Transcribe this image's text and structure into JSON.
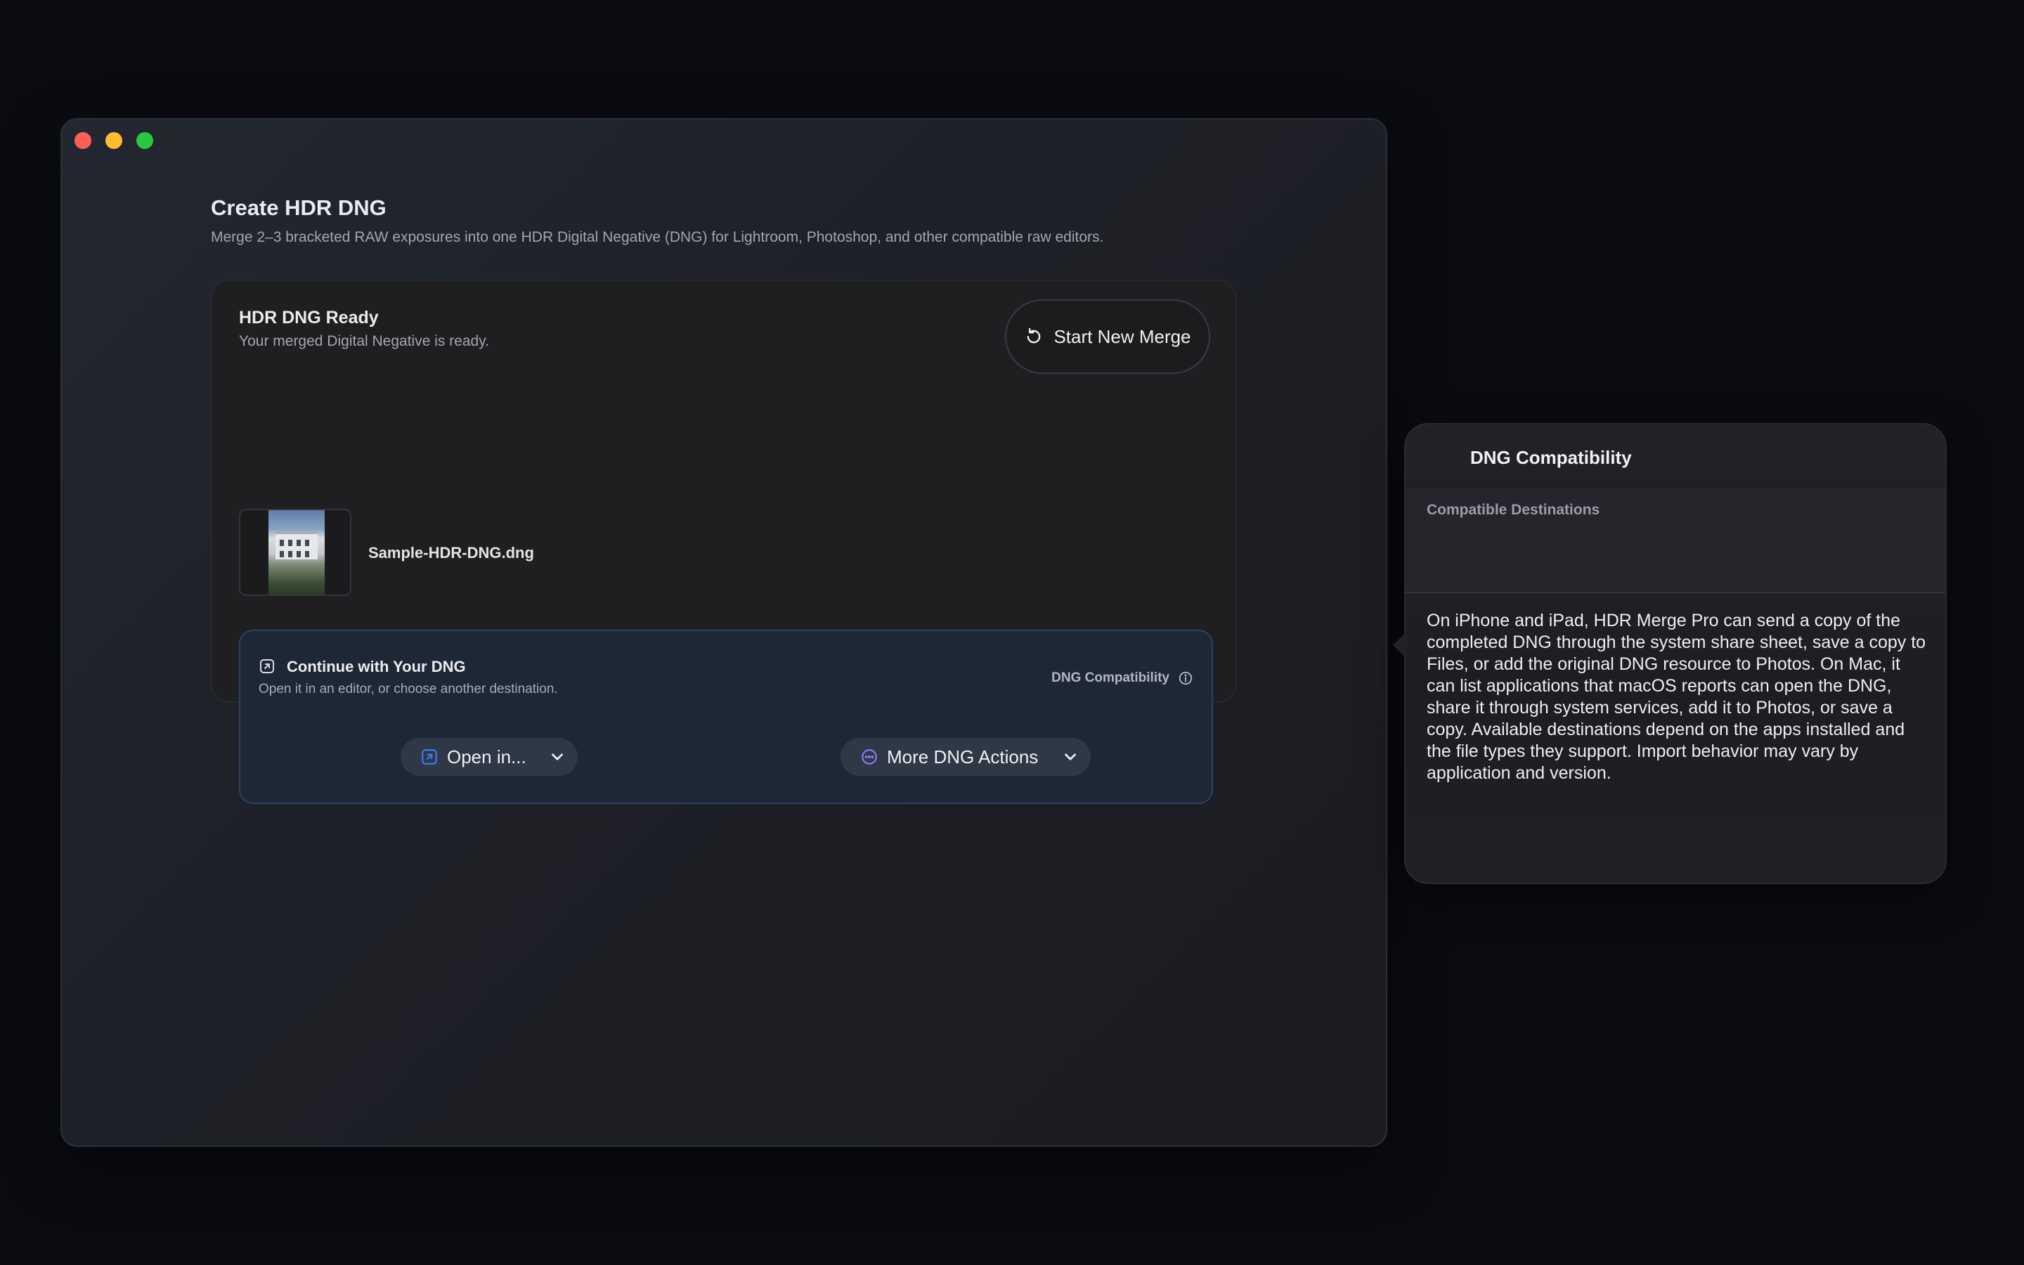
{
  "window": {
    "title": "Create HDR DNG",
    "subtitle": "Merge 2–3 bracketed RAW exposures into one HDR Digital Negative (DNG) for Lightroom, Photoshop, and other compatible raw editors."
  },
  "result_card": {
    "title": "HDR DNG Ready",
    "subtitle": "Your merged Digital Negative is ready.",
    "start_button_label": "Start New Merge",
    "start_button_icon": "arrow-counterclockwise-icon",
    "file": {
      "name": "Sample-HDR-DNG.dng",
      "thumbnail_icon": "photo-thumbnail"
    }
  },
  "continue_section": {
    "title": "Continue with Your DNG",
    "subtitle": "Open it in an editor, or choose another destination.",
    "compat_link_label": "DNG Compatibility",
    "open_button_label": "Open in...",
    "more_button_label": "More DNG Actions"
  },
  "popover": {
    "title": "DNG Compatibility",
    "section_label": "Compatible Destinations",
    "body": "On iPhone and iPad, HDR Merge Pro can send a copy of the completed DNG through the system share sheet, save a copy to Files, or add the original DNG resource to Photos. On Mac, it can list applications that macOS reports can open the DNG, share it through system services, add it to Photos, or save a copy. Available destinations depend on the apps installed and the file types they support. Import behavior may vary by application and version."
  },
  "colors": {
    "accent": "#3d7bf5",
    "accent_purple": "#8c7bf0",
    "window_bg": "#1f2128",
    "desktop_bg": "#0b0c11"
  }
}
